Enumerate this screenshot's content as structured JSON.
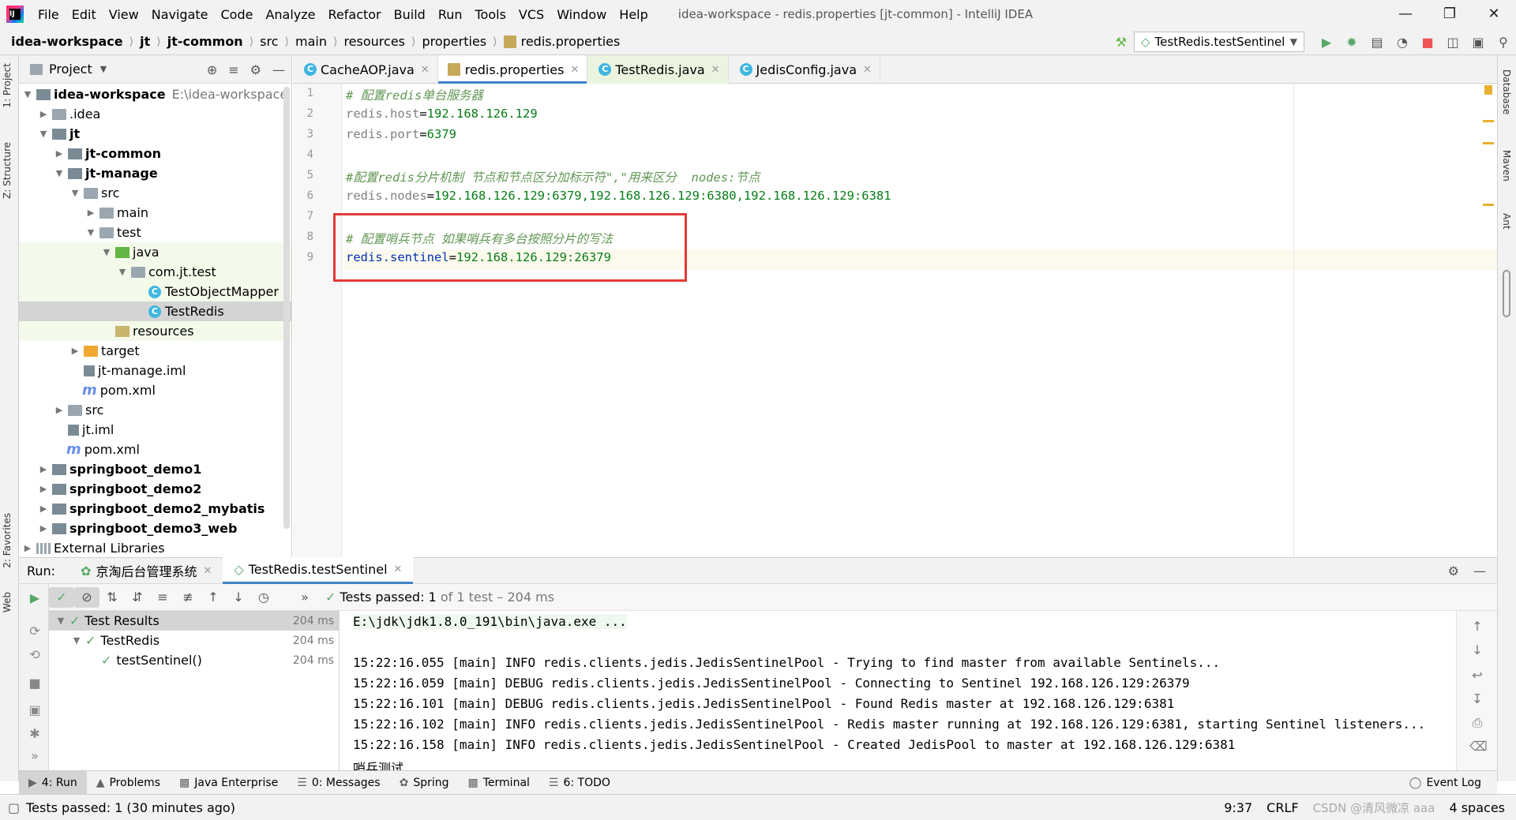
{
  "menubar": {
    "items": [
      "File",
      "Edit",
      "View",
      "Navigate",
      "Code",
      "Analyze",
      "Refactor",
      "Build",
      "Run",
      "Tools",
      "VCS",
      "Window",
      "Help"
    ],
    "title": "idea-workspace - redis.properties [jt-common] - IntelliJ IDEA"
  },
  "breadcrumbs": [
    "idea-workspace",
    "jt",
    "jt-common",
    "src",
    "main",
    "resources",
    "properties",
    "redis.properties"
  ],
  "run_config": "TestRedis.testSentinel",
  "left_stripe": {
    "project": "1: Project",
    "structure": "Z: Structure",
    "favorites": "2: Favorites",
    "web": "Web"
  },
  "right_stripe": {
    "database": "Database",
    "maven": "Maven",
    "ant": "Ant"
  },
  "project_panel": {
    "title": "Project",
    "tree": [
      {
        "label": "idea-workspace",
        "path": "E:\\idea-workspace"
      },
      {
        "label": ".idea"
      },
      {
        "label": "jt"
      },
      {
        "label": "jt-common"
      },
      {
        "label": "jt-manage"
      },
      {
        "label": "src"
      },
      {
        "label": "main"
      },
      {
        "label": "test"
      },
      {
        "label": "java"
      },
      {
        "label": "com.jt.test"
      },
      {
        "label": "TestObjectMapper"
      },
      {
        "label": "TestRedis"
      },
      {
        "label": "resources"
      },
      {
        "label": "target"
      },
      {
        "label": "jt-manage.iml"
      },
      {
        "label": "pom.xml"
      },
      {
        "label": "src"
      },
      {
        "label": "jt.iml"
      },
      {
        "label": "pom.xml"
      },
      {
        "label": "springboot_demo1"
      },
      {
        "label": "springboot_demo2"
      },
      {
        "label": "springboot_demo2_mybatis"
      },
      {
        "label": "springboot_demo3_web"
      },
      {
        "label": "External Libraries"
      }
    ]
  },
  "editor_tabs": [
    "CacheAOP.java",
    "redis.properties",
    "TestRedis.java",
    "JedisConfig.java"
  ],
  "editor": {
    "line_numbers": [
      "1",
      "2",
      "3",
      "4",
      "5",
      "6",
      "7",
      "8",
      "9"
    ],
    "l1": "# 配置redis单台服务器",
    "l2_key": "redis.host",
    "l2_val": "192.168.126.129",
    "l3_key": "redis.port",
    "l3_val": "6379",
    "l5": "#配置redis分片机制 节点和节点区分加标示符\",\"用来区分  nodes:节点",
    "l6_key": "redis.nodes",
    "l6_val": "192.168.126.129:6379,192.168.126.129:6380,192.168.126.129:6381",
    "l8": "# 配置哨兵节点 如果哨兵有多台按照分片的写法",
    "l9_key": "redis.sentinel",
    "l9_val": "192.168.126.129:26379",
    "eq": "="
  },
  "run_panel": {
    "label": "Run:",
    "tabs": [
      "京淘后台管理系统",
      "TestRedis.testSentinel"
    ],
    "status_prefix": "Tests passed:",
    "status_count": "1",
    "status_suffix": "of 1 test – 204 ms",
    "tree": [
      {
        "label": "Test Results",
        "time": "204 ms"
      },
      {
        "label": "TestRedis",
        "time": "204 ms"
      },
      {
        "label": "testSentinel()",
        "time": "204 ms"
      }
    ],
    "console": [
      "E:\\jdk\\jdk1.8.0_191\\bin\\java.exe ...",
      "",
      "15:22:16.055 [main] INFO redis.clients.jedis.JedisSentinelPool - Trying to find master from available Sentinels...",
      "15:22:16.059 [main] DEBUG redis.clients.jedis.JedisSentinelPool - Connecting to Sentinel 192.168.126.129:26379",
      "15:22:16.101 [main] DEBUG redis.clients.jedis.JedisSentinelPool - Found Redis master at 192.168.126.129:6381",
      "15:22:16.102 [main] INFO redis.clients.jedis.JedisSentinelPool - Redis master running at 192.168.126.129:6381, starting Sentinel listeners...",
      "15:22:16.158 [main] INFO redis.clients.jedis.JedisSentinelPool - Created JedisPool to master at 192.168.126.129:6381",
      "哨兵测试"
    ]
  },
  "tool_stripe": {
    "items": [
      "4: Run",
      "Problems",
      "Java Enterprise",
      "0: Messages",
      "Spring",
      "Terminal",
      "6: TODO"
    ],
    "event_log": "Event Log"
  },
  "statusbar": {
    "message": "Tests passed: 1 (30 minutes ago)",
    "position": "9:37",
    "line_sep": "CRLF",
    "watermark": "CSDN @清风微凉 aaa",
    "indent": "4 spaces"
  }
}
